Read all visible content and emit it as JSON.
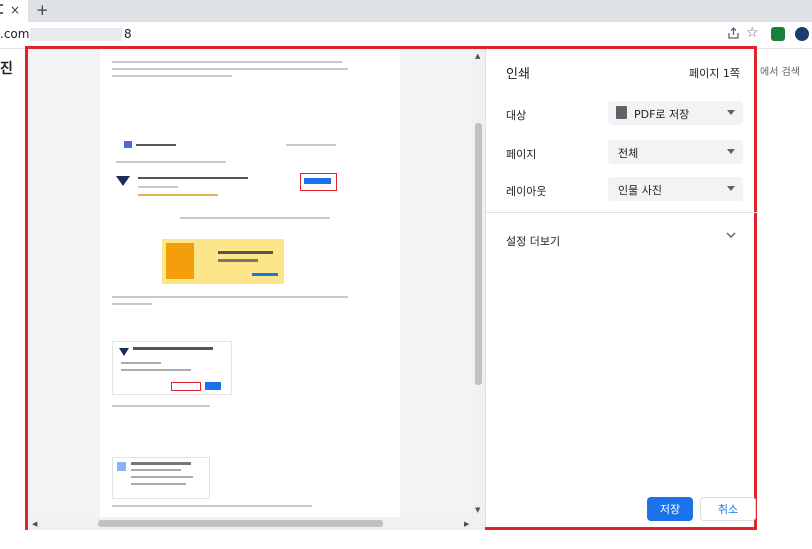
{
  "browser": {
    "tab_close": "×",
    "new_tab": "+",
    "url_prefix": ".com",
    "url_suffix": "8",
    "share_icon": "share-icon",
    "star_icon": "star-icon"
  },
  "background": {
    "left_text": "진",
    "right_text": "에서 검색"
  },
  "print": {
    "title": "인쇄",
    "pages_count": "페이지 1쪽",
    "destination_label": "대상",
    "destination_value": "PDF로 저장",
    "pages_label": "페이지",
    "pages_value": "전체",
    "layout_label": "레이아웃",
    "layout_value": "인물 사진",
    "more_settings": "설정 더보기",
    "save_button": "저장",
    "cancel_button": "취소"
  },
  "colors": {
    "accent": "#1a73e8",
    "highlight_border": "#e0242b"
  }
}
